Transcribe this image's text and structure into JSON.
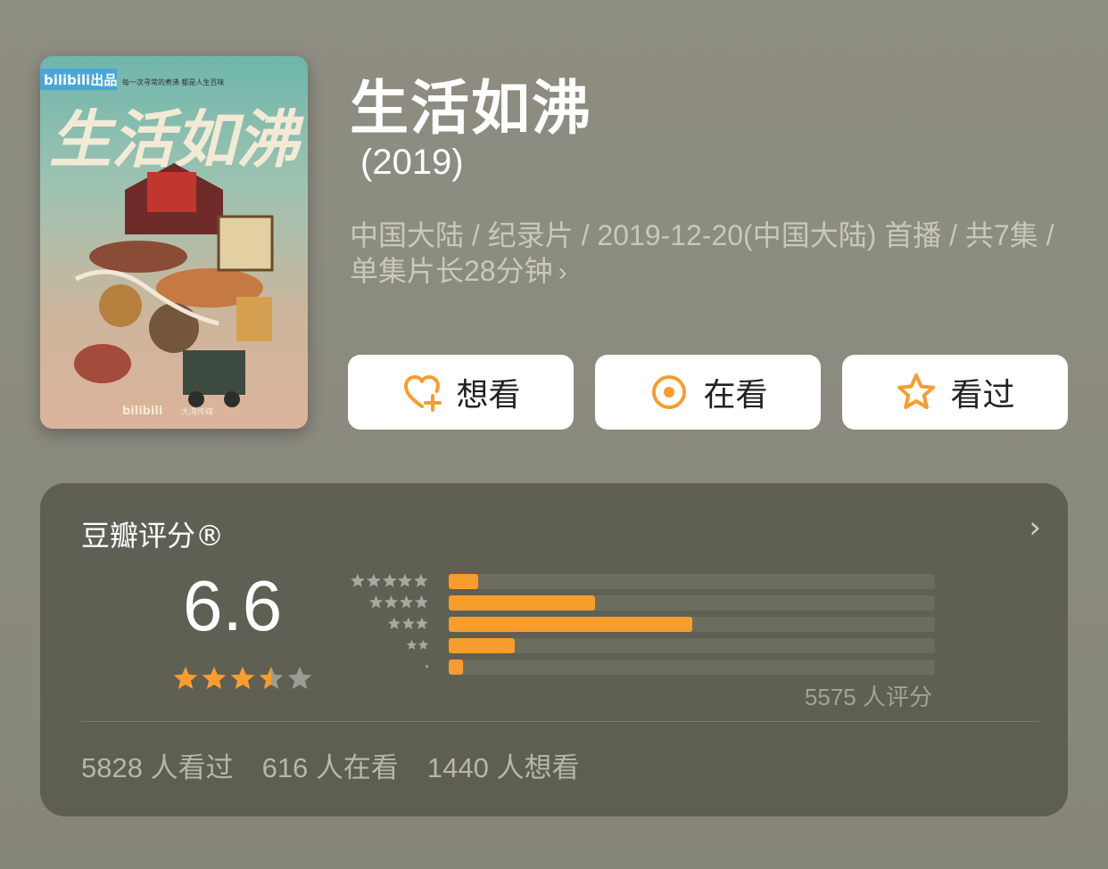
{
  "poster": {
    "brand": "bilibili出品",
    "tagline": "每一次寻常的煮沸 都是人生百味",
    "calligraphy": "生活如沸",
    "footer_logo": "bilibili",
    "footer_studio": "大湾传媒",
    "colors": {
      "teal": "#72b8ad",
      "pink": "#d9b19a"
    }
  },
  "title": "生活如沸",
  "year": "(2019)",
  "meta": {
    "text": "中国大陆 / 纪录片 / 2019-12-20(中国大陆) 首播 / 共7集 / 单集片长28分钟",
    "chevron": "›"
  },
  "actions": [
    {
      "label": "想看",
      "icon": "heart-plus-icon"
    },
    {
      "label": "在看",
      "icon": "target-circle-icon"
    },
    {
      "label": "看过",
      "icon": "star-outline-icon"
    }
  ],
  "rating": {
    "title": "豆瓣评分®",
    "chevron": "›",
    "score": "6.6",
    "stars": 3.5,
    "distribution": [
      {
        "stars": 5,
        "fraction": 0.06
      },
      {
        "stars": 4,
        "fraction": 0.3
      },
      {
        "stars": 3,
        "fraction": 0.5
      },
      {
        "stars": 2,
        "fraction": 0.135
      },
      {
        "stars": 1,
        "fraction": 0.03
      }
    ],
    "total": "5575 人评分",
    "stats": [
      "5828 人看过",
      "616 人在看",
      "1440 人想看"
    ]
  },
  "colors": {
    "accent": "#f79d2e",
    "gray_star": "#9d9c92",
    "dist_star": "#a9a89e"
  }
}
